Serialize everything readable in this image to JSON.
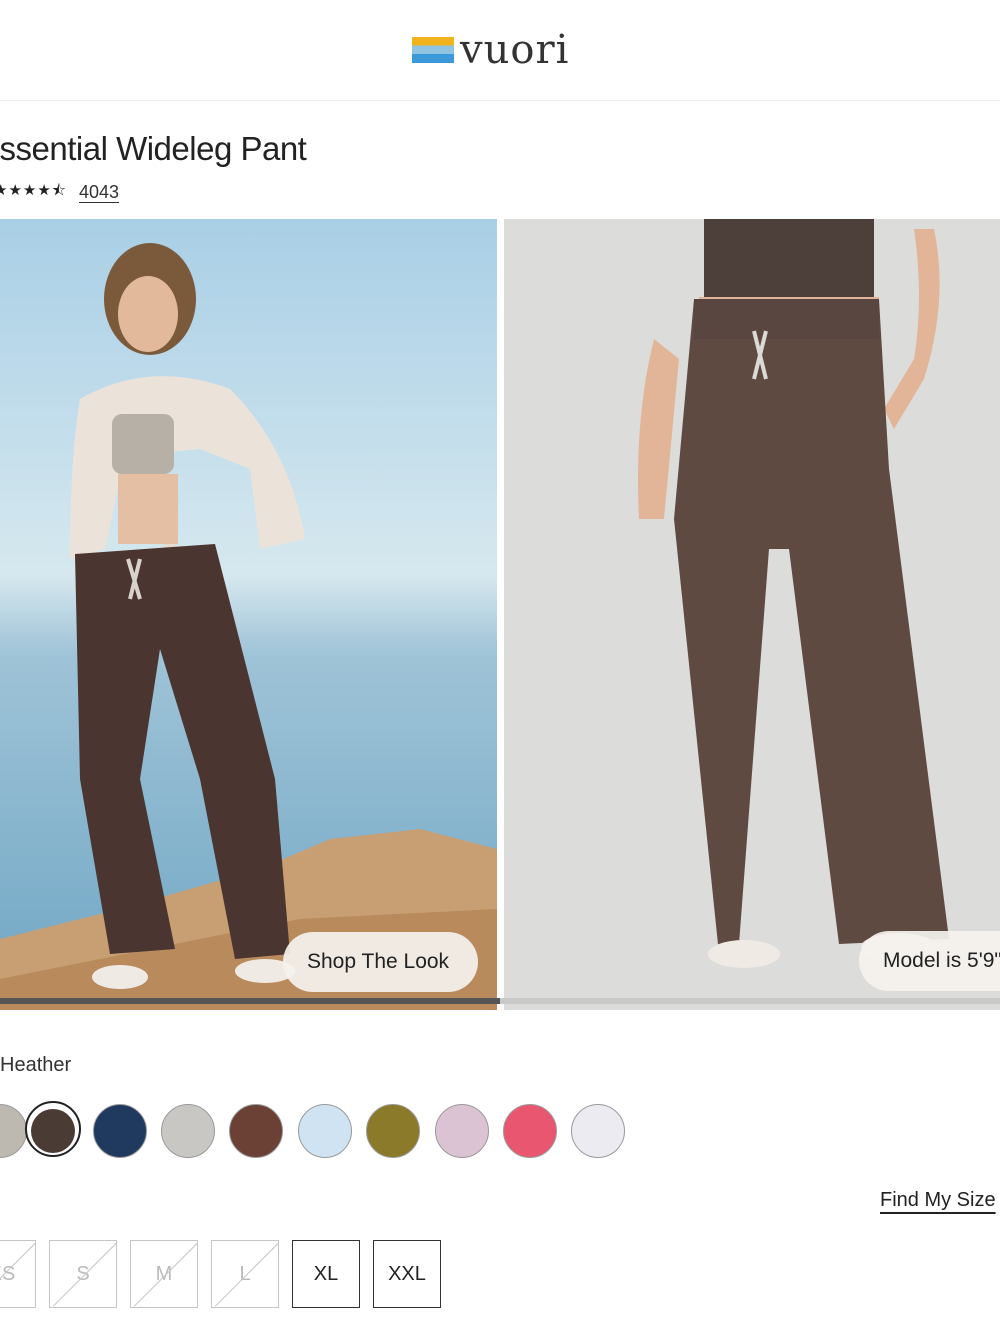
{
  "header": {
    "logo_text": "vuori",
    "logo_icon": "vuori-stripes-logo"
  },
  "product": {
    "title": "Essential Wideleg Pant",
    "rating_stars": "★★★★⯪",
    "review_count": "4043"
  },
  "gallery": {
    "image1_pill": "Shop The Look",
    "image2_pill": "Model is 5'9\"",
    "progress": 0.5
  },
  "colors": {
    "selected_name": "Heather",
    "swatches": [
      "#bdb9b1",
      "#4a3b35",
      "#1f3a5e",
      "#c9c7c4",
      "#6b4135",
      "#cfe3f2",
      "#8b7a2a",
      "#dcc3d4",
      "#e9566f",
      "#ecebf1"
    ],
    "selected_index": 1
  },
  "sizes": {
    "find_my_size": "Find My Size",
    "options": [
      {
        "label": "XS",
        "available": false
      },
      {
        "label": "S",
        "available": false
      },
      {
        "label": "M",
        "available": false
      },
      {
        "label": "L",
        "available": false
      },
      {
        "label": "XL",
        "available": true
      },
      {
        "label": "XXL",
        "available": true
      }
    ]
  }
}
